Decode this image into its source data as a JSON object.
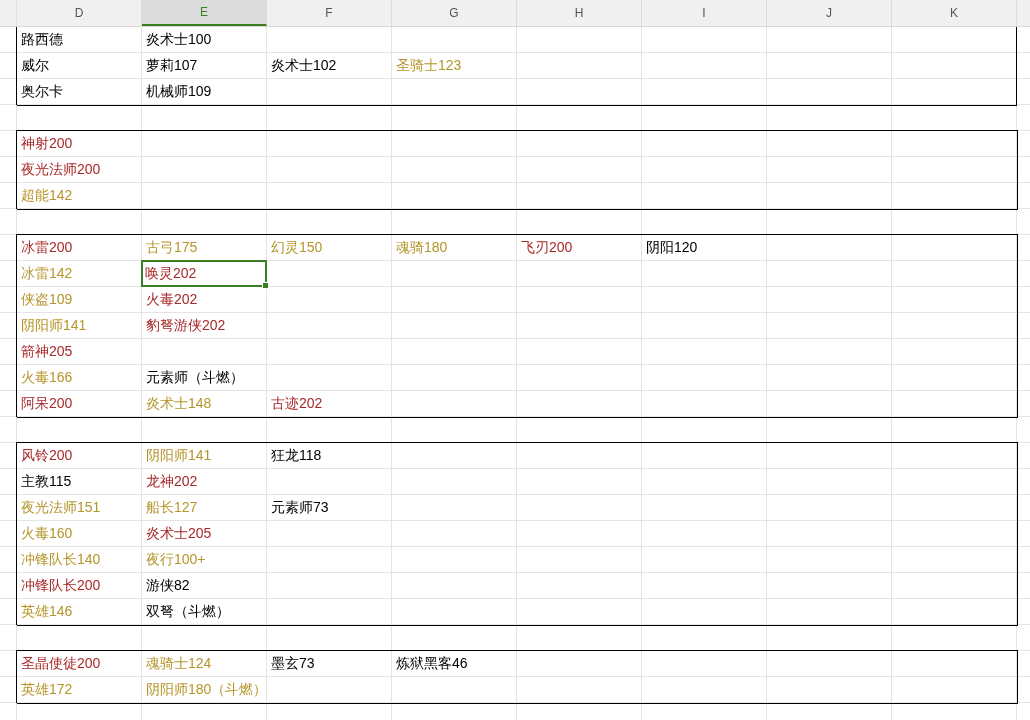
{
  "columns": [
    {
      "label": "D",
      "selected": false
    },
    {
      "label": "E",
      "selected": true
    },
    {
      "label": "F",
      "selected": false
    },
    {
      "label": "G",
      "selected": false
    },
    {
      "label": "H",
      "selected": false
    },
    {
      "label": "I",
      "selected": false
    },
    {
      "label": "J",
      "selected": false
    },
    {
      "label": "K",
      "selected": false
    }
  ],
  "groups": [
    {
      "rows": [
        [
          {
            "text": "路西德",
            "color": "#000000",
            "selected": false
          },
          {
            "text": "炎术士100",
            "color": "#000000",
            "selected": false
          }
        ],
        [
          {
            "text": "威尔",
            "color": "#000000",
            "selected": false
          },
          {
            "text": "萝莉107",
            "color": "#000000",
            "selected": false
          },
          {
            "text": "炎术士102",
            "color": "#000000",
            "selected": false
          },
          {
            "text": "圣骑士123",
            "color": "#b5952b",
            "selected": false
          }
        ],
        [
          {
            "text": "奥尔卡",
            "color": "#000000",
            "selected": false
          },
          {
            "text": "机械师109",
            "color": "#000000",
            "selected": false
          }
        ]
      ]
    },
    {
      "rows": [
        [
          {
            "text": "神射200",
            "color": "#a82828",
            "selected": false
          }
        ],
        [
          {
            "text": "夜光法师200",
            "color": "#a82828",
            "selected": false
          }
        ],
        [
          {
            "text": "超能142",
            "color": "#b5952b",
            "selected": false
          }
        ]
      ]
    },
    {
      "rows": [
        [
          {
            "text": "冰雷200",
            "color": "#a82828",
            "selected": false
          },
          {
            "text": "古弓175",
            "color": "#b5952b",
            "selected": false
          },
          {
            "text": "幻灵150",
            "color": "#b5952b",
            "selected": false
          },
          {
            "text": "魂骑180",
            "color": "#b5952b",
            "selected": false
          },
          {
            "text": "飞刃200",
            "color": "#a82828",
            "selected": false
          },
          {
            "text": "阴阳120",
            "color": "#000000",
            "selected": false
          }
        ],
        [
          {
            "text": "冰雷142",
            "color": "#b5952b",
            "selected": false
          },
          {
            "text": "唤灵202",
            "color": "#a82828",
            "selected": true
          }
        ],
        [
          {
            "text": "侠盗109",
            "color": "#b5952b",
            "selected": false
          },
          {
            "text": "火毒202",
            "color": "#a82828",
            "selected": false
          }
        ],
        [
          {
            "text": "阴阳师141",
            "color": "#b5952b",
            "selected": false
          },
          {
            "text": "豹弩游侠202",
            "color": "#a82828",
            "selected": false
          }
        ],
        [
          {
            "text": "箭神205",
            "color": "#a82828",
            "selected": false
          }
        ],
        [
          {
            "text": "火毒166",
            "color": "#b5952b",
            "selected": false
          },
          {
            "text": "元素师（斗燃）",
            "color": "#000000",
            "selected": false
          }
        ],
        [
          {
            "text": "阿呆200",
            "color": "#a82828",
            "selected": false
          },
          {
            "text": "炎术士148",
            "color": "#b5952b",
            "selected": false
          },
          {
            "text": "古迹202",
            "color": "#a82828",
            "selected": false
          }
        ]
      ]
    },
    {
      "rows": [
        [
          {
            "text": "风铃200",
            "color": "#a82828",
            "selected": false
          },
          {
            "text": "阴阳师141",
            "color": "#b5952b",
            "selected": false
          },
          {
            "text": "狂龙118",
            "color": "#000000",
            "selected": false
          }
        ],
        [
          {
            "text": "主教115",
            "color": "#000000",
            "selected": false
          },
          {
            "text": "龙神202",
            "color": "#a82828",
            "selected": false
          }
        ],
        [
          {
            "text": "夜光法师151",
            "color": "#b5952b",
            "selected": false
          },
          {
            "text": "船长127",
            "color": "#b5952b",
            "selected": false
          },
          {
            "text": "元素师73",
            "color": "#000000",
            "selected": false
          }
        ],
        [
          {
            "text": "火毒160",
            "color": "#b5952b",
            "selected": false
          },
          {
            "text": "炎术士205",
            "color": "#a82828",
            "selected": false
          }
        ],
        [
          {
            "text": "冲锋队长140",
            "color": "#b5952b",
            "selected": false
          },
          {
            "text": "夜行100+",
            "color": "#b5952b",
            "selected": false
          }
        ],
        [
          {
            "text": "冲锋队长200",
            "color": "#a82828",
            "selected": false
          },
          {
            "text": "游侠82",
            "color": "#000000",
            "selected": false
          }
        ],
        [
          {
            "text": "英雄146",
            "color": "#b5952b",
            "selected": false
          },
          {
            "text": "双弩（斗燃）",
            "color": "#000000",
            "selected": false
          }
        ]
      ]
    },
    {
      "rows": [
        [
          {
            "text": "圣晶使徒200",
            "color": "#a82828",
            "selected": false
          },
          {
            "text": "魂骑士124",
            "color": "#b5952b",
            "selected": false
          },
          {
            "text": "墨玄73",
            "color": "#000000",
            "selected": false
          },
          {
            "text": "炼狱黑客46",
            "color": "#000000",
            "selected": false
          }
        ],
        [
          {
            "text": "英雄172",
            "color": "#b5952b",
            "selected": false
          },
          {
            "text": "阴阳师180（斗燃）",
            "color": "#b5952b",
            "selected": false
          }
        ]
      ]
    }
  ]
}
